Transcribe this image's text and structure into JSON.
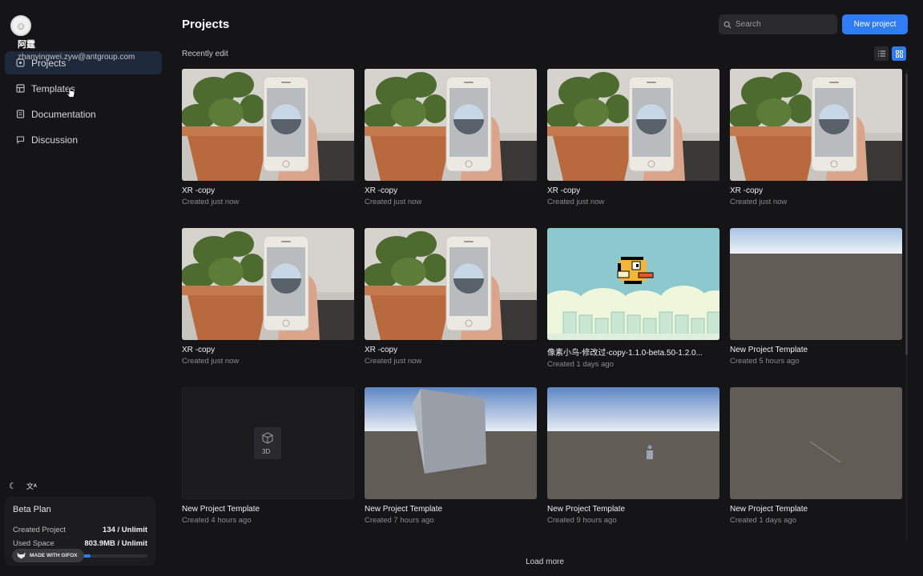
{
  "user": {
    "name": "阿霆",
    "email": "zhanyingwei.zyw@antgroup.com"
  },
  "nav": [
    {
      "label": "Projects",
      "icon": "projects-icon",
      "active": true
    },
    {
      "label": "Templates",
      "icon": "templates-icon",
      "active": false
    },
    {
      "label": "Documentation",
      "icon": "documentation-icon",
      "active": false
    },
    {
      "label": "Discussion",
      "icon": "discussion-icon",
      "active": false
    }
  ],
  "plan": {
    "title": "Beta Plan",
    "created_label": "Created Project",
    "created_value": "134 / Unlimit",
    "space_label": "Used Space",
    "space_value": "803.9MB / Unlimit",
    "space_fraction": 0.58
  },
  "gifox_badge": "MADE WITH GIFOX",
  "header": {
    "title": "Projects",
    "search_placeholder": "Search",
    "new_project_label": "New project"
  },
  "section_label": "Recently edit",
  "projects": [
    {
      "title": "XR -copy",
      "created": "Created just now",
      "thumb": "xr"
    },
    {
      "title": "XR -copy",
      "created": "Created just now",
      "thumb": "xr"
    },
    {
      "title": "XR -copy",
      "created": "Created just now",
      "thumb": "xr"
    },
    {
      "title": "XR -copy",
      "created": "Created just now",
      "thumb": "xr"
    },
    {
      "title": "XR -copy",
      "created": "Created just now",
      "thumb": "xr"
    },
    {
      "title": "XR -copy",
      "created": "Created just now",
      "thumb": "xr"
    },
    {
      "title": "像素小鸟-修改过-copy-1.1.0-beta.50-1.2.0...",
      "created": "Created 1 days ago",
      "thumb": "bird"
    },
    {
      "title": "New Project Template",
      "created": "Created 5 hours ago",
      "thumb": "sky"
    },
    {
      "title": "New Project Template",
      "created": "Created 4 hours ago",
      "thumb": "empty3d",
      "badge": "3D"
    },
    {
      "title": "New Project Template",
      "created": "Created 7 hours ago",
      "thumb": "cube"
    },
    {
      "title": "New Project Template",
      "created": "Created 9 hours ago",
      "thumb": "figure"
    },
    {
      "title": "New Project Template",
      "created": "Created 1 days ago",
      "thumb": "line"
    }
  ],
  "load_more": "Load more",
  "colors": {
    "accent": "#2f7cf6",
    "background": "#151517",
    "active_nav": "#1e2a3c"
  }
}
